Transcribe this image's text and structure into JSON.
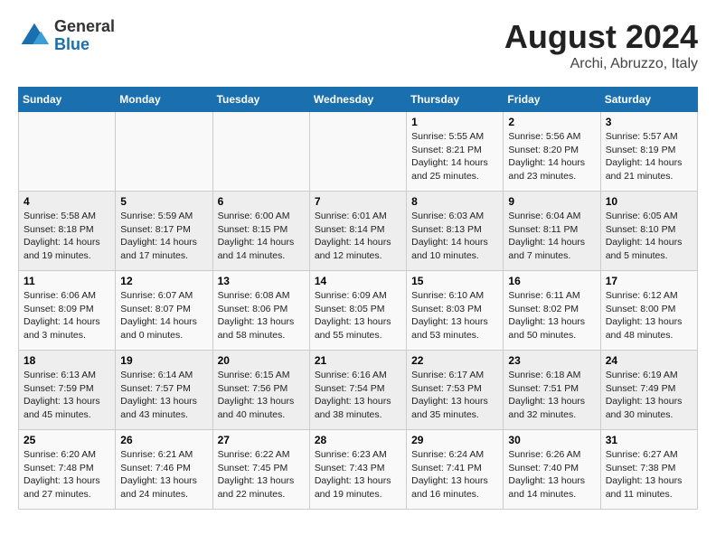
{
  "logo": {
    "general": "General",
    "blue": "Blue"
  },
  "title": "August 2024",
  "subtitle": "Archi, Abruzzo, Italy",
  "days_of_week": [
    "Sunday",
    "Monday",
    "Tuesday",
    "Wednesday",
    "Thursday",
    "Friday",
    "Saturday"
  ],
  "weeks": [
    [
      {
        "day": "",
        "info": ""
      },
      {
        "day": "",
        "info": ""
      },
      {
        "day": "",
        "info": ""
      },
      {
        "day": "",
        "info": ""
      },
      {
        "day": "1",
        "info": "Sunrise: 5:55 AM\nSunset: 8:21 PM\nDaylight: 14 hours and 25 minutes."
      },
      {
        "day": "2",
        "info": "Sunrise: 5:56 AM\nSunset: 8:20 PM\nDaylight: 14 hours and 23 minutes."
      },
      {
        "day": "3",
        "info": "Sunrise: 5:57 AM\nSunset: 8:19 PM\nDaylight: 14 hours and 21 minutes."
      }
    ],
    [
      {
        "day": "4",
        "info": "Sunrise: 5:58 AM\nSunset: 8:18 PM\nDaylight: 14 hours and 19 minutes."
      },
      {
        "day": "5",
        "info": "Sunrise: 5:59 AM\nSunset: 8:17 PM\nDaylight: 14 hours and 17 minutes."
      },
      {
        "day": "6",
        "info": "Sunrise: 6:00 AM\nSunset: 8:15 PM\nDaylight: 14 hours and 14 minutes."
      },
      {
        "day": "7",
        "info": "Sunrise: 6:01 AM\nSunset: 8:14 PM\nDaylight: 14 hours and 12 minutes."
      },
      {
        "day": "8",
        "info": "Sunrise: 6:03 AM\nSunset: 8:13 PM\nDaylight: 14 hours and 10 minutes."
      },
      {
        "day": "9",
        "info": "Sunrise: 6:04 AM\nSunset: 8:11 PM\nDaylight: 14 hours and 7 minutes."
      },
      {
        "day": "10",
        "info": "Sunrise: 6:05 AM\nSunset: 8:10 PM\nDaylight: 14 hours and 5 minutes."
      }
    ],
    [
      {
        "day": "11",
        "info": "Sunrise: 6:06 AM\nSunset: 8:09 PM\nDaylight: 14 hours and 3 minutes."
      },
      {
        "day": "12",
        "info": "Sunrise: 6:07 AM\nSunset: 8:07 PM\nDaylight: 14 hours and 0 minutes."
      },
      {
        "day": "13",
        "info": "Sunrise: 6:08 AM\nSunset: 8:06 PM\nDaylight: 13 hours and 58 minutes."
      },
      {
        "day": "14",
        "info": "Sunrise: 6:09 AM\nSunset: 8:05 PM\nDaylight: 13 hours and 55 minutes."
      },
      {
        "day": "15",
        "info": "Sunrise: 6:10 AM\nSunset: 8:03 PM\nDaylight: 13 hours and 53 minutes."
      },
      {
        "day": "16",
        "info": "Sunrise: 6:11 AM\nSunset: 8:02 PM\nDaylight: 13 hours and 50 minutes."
      },
      {
        "day": "17",
        "info": "Sunrise: 6:12 AM\nSunset: 8:00 PM\nDaylight: 13 hours and 48 minutes."
      }
    ],
    [
      {
        "day": "18",
        "info": "Sunrise: 6:13 AM\nSunset: 7:59 PM\nDaylight: 13 hours and 45 minutes."
      },
      {
        "day": "19",
        "info": "Sunrise: 6:14 AM\nSunset: 7:57 PM\nDaylight: 13 hours and 43 minutes."
      },
      {
        "day": "20",
        "info": "Sunrise: 6:15 AM\nSunset: 7:56 PM\nDaylight: 13 hours and 40 minutes."
      },
      {
        "day": "21",
        "info": "Sunrise: 6:16 AM\nSunset: 7:54 PM\nDaylight: 13 hours and 38 minutes."
      },
      {
        "day": "22",
        "info": "Sunrise: 6:17 AM\nSunset: 7:53 PM\nDaylight: 13 hours and 35 minutes."
      },
      {
        "day": "23",
        "info": "Sunrise: 6:18 AM\nSunset: 7:51 PM\nDaylight: 13 hours and 32 minutes."
      },
      {
        "day": "24",
        "info": "Sunrise: 6:19 AM\nSunset: 7:49 PM\nDaylight: 13 hours and 30 minutes."
      }
    ],
    [
      {
        "day": "25",
        "info": "Sunrise: 6:20 AM\nSunset: 7:48 PM\nDaylight: 13 hours and 27 minutes."
      },
      {
        "day": "26",
        "info": "Sunrise: 6:21 AM\nSunset: 7:46 PM\nDaylight: 13 hours and 24 minutes."
      },
      {
        "day": "27",
        "info": "Sunrise: 6:22 AM\nSunset: 7:45 PM\nDaylight: 13 hours and 22 minutes."
      },
      {
        "day": "28",
        "info": "Sunrise: 6:23 AM\nSunset: 7:43 PM\nDaylight: 13 hours and 19 minutes."
      },
      {
        "day": "29",
        "info": "Sunrise: 6:24 AM\nSunset: 7:41 PM\nDaylight: 13 hours and 16 minutes."
      },
      {
        "day": "30",
        "info": "Sunrise: 6:26 AM\nSunset: 7:40 PM\nDaylight: 13 hours and 14 minutes."
      },
      {
        "day": "31",
        "info": "Sunrise: 6:27 AM\nSunset: 7:38 PM\nDaylight: 13 hours and 11 minutes."
      }
    ]
  ]
}
